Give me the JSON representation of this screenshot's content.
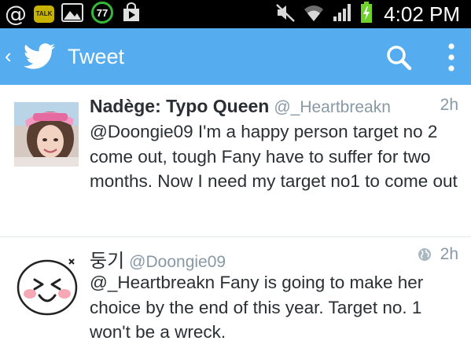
{
  "status_bar": {
    "time": "4:02 PM",
    "left_icons": [
      "at-sign-icon",
      "kakaotalk-icon",
      "gallery-icon",
      "sync-counter-icon",
      "play-store-icon"
    ],
    "kakaotalk_label": "TALK",
    "sync_count": "77",
    "right_icons": [
      "mute-icon",
      "wifi-icon",
      "signal-icon",
      "battery-charging-icon"
    ]
  },
  "action_bar": {
    "title": "Tweet",
    "color": "#55acee",
    "icons": [
      "back-chevron-icon",
      "twitter-bird-icon",
      "search-icon",
      "overflow-menu-icon"
    ]
  },
  "tweets": [
    {
      "display_name": "Nadège: Typo Queen",
      "handle": "@_Heartbreakn",
      "time": "2h",
      "text": "@Doongie09 I'm a happy person target no 2 come out, tough Fany have to suffer for two months. Now I need my target no1 to come out"
    },
    {
      "display_name": "둥기",
      "handle": "@Doongie09",
      "time": "2h",
      "geo_icon": "globe-icon",
      "text": "@_Heartbreakn Fany is going to make her choice by the end of this year. Target no. 1 won't be a wreck."
    }
  ]
}
